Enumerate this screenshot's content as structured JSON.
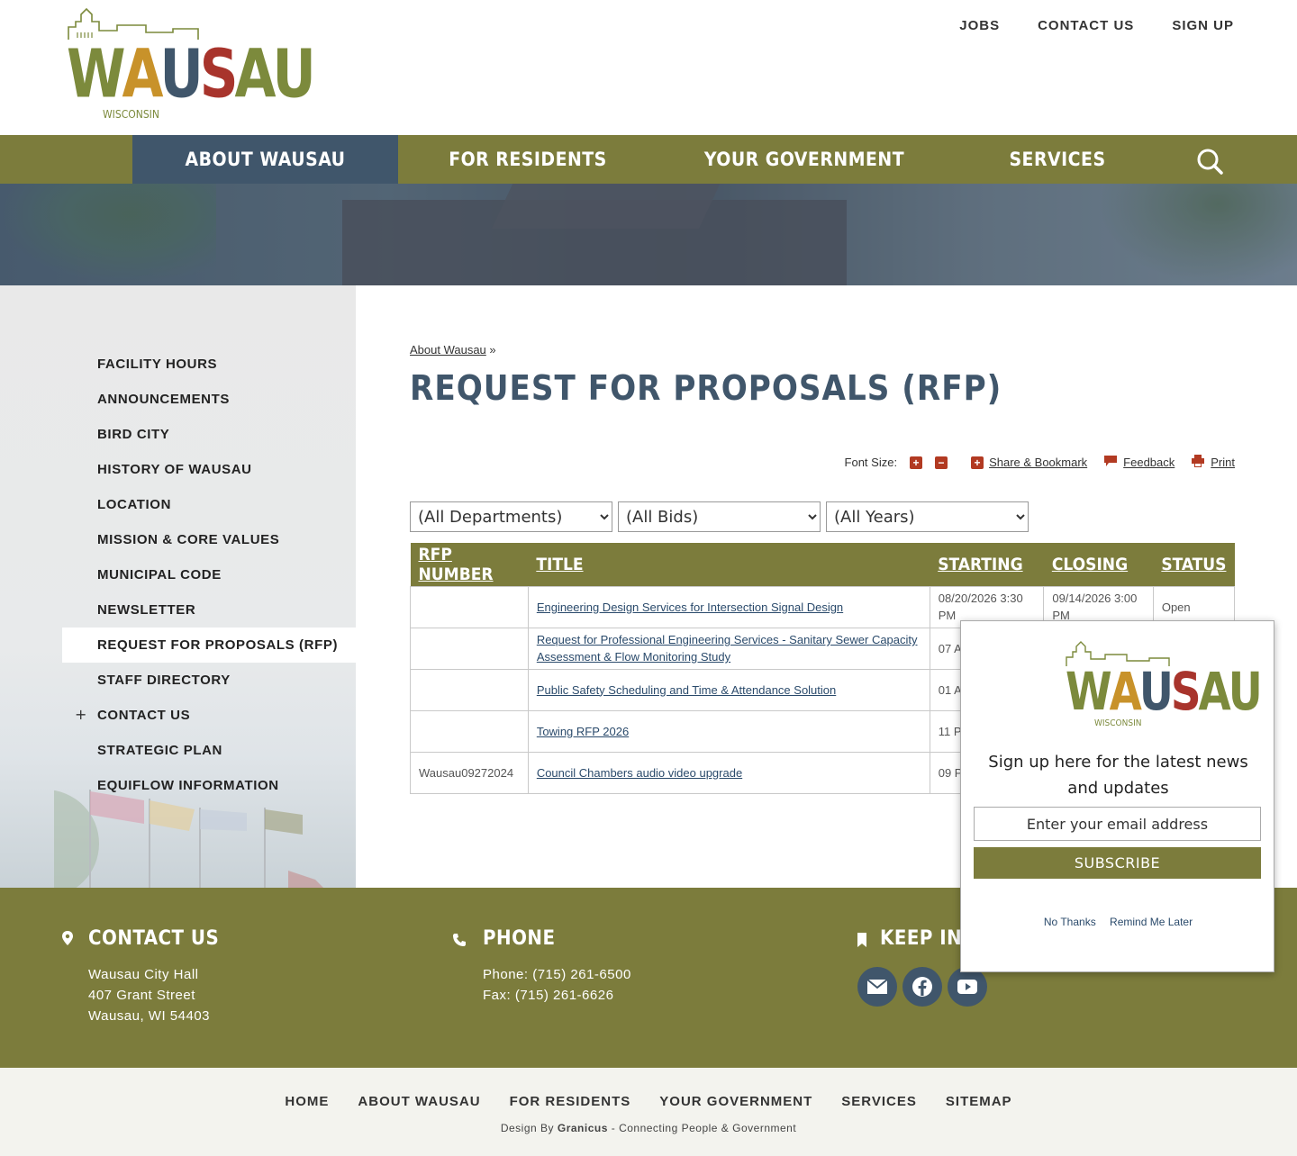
{
  "brand": {
    "name_letters": [
      "W",
      "A",
      "U",
      "S",
      "A",
      "U"
    ],
    "letter_colors": [
      "#7c8a3c",
      "#c8922a",
      "#40566b",
      "#a8342c",
      "#7c8a3c",
      "#7c8a3c"
    ],
    "subtitle": "WISCONSIN"
  },
  "top_links": [
    "JOBS",
    "CONTACT US",
    "SIGN UP"
  ],
  "main_nav": [
    "ABOUT WAUSAU",
    "FOR RESIDENTS",
    "YOUR GOVERNMENT",
    "SERVICES"
  ],
  "sidebar": {
    "items": [
      {
        "label": "FACILITY HOURS"
      },
      {
        "label": "ANNOUNCEMENTS"
      },
      {
        "label": "BIRD CITY"
      },
      {
        "label": "HISTORY OF WAUSAU"
      },
      {
        "label": "LOCATION"
      },
      {
        "label": "MISSION & CORE VALUES"
      },
      {
        "label": "MUNICIPAL CODE"
      },
      {
        "label": "NEWSLETTER"
      },
      {
        "label": "REQUEST FOR PROPOSALS (RFP)"
      },
      {
        "label": "STAFF DIRECTORY"
      },
      {
        "label": "CONTACT US"
      },
      {
        "label": "STRATEGIC PLAN"
      },
      {
        "label": "EQUIFLOW INFORMATION"
      }
    ],
    "expand_symbol": "+"
  },
  "breadcrumb": {
    "link": "About Wausau",
    "separator": "»"
  },
  "page_title": "REQUEST FOR PROPOSALS (RFP)",
  "tools": {
    "font_size_label": "Font Size:",
    "increase": "+",
    "decrease": "−",
    "share": "Share & Bookmark",
    "feedback": "Feedback",
    "print": "Print"
  },
  "filters": {
    "department": "(All Departments)",
    "bids": "(All Bids)",
    "years": "(All Years)"
  },
  "table": {
    "headers": [
      "RFP NUMBER",
      "TITLE",
      "STARTING",
      "CLOSING",
      "STATUS"
    ],
    "rows": [
      {
        "number": "",
        "title": "Engineering Design Services for Intersection Signal Design",
        "starting": "08/20/2026 3:30 PM",
        "closing": "09/14/2026 3:00 PM",
        "status": "Open"
      },
      {
        "number": "",
        "title": "Request for Professional Engineering Services - Sanitary Sewer Capacity Assessment & Flow Monitoring Study",
        "starting": "07 AM",
        "closing": "",
        "status": ""
      },
      {
        "number": "",
        "title": "Public Safety Scheduling and Time & Attendance Solution",
        "starting": "01 AM",
        "closing": "",
        "status": ""
      },
      {
        "number": "",
        "title": "Towing RFP 2026",
        "starting": "11 PM",
        "closing": "",
        "status": ""
      },
      {
        "number": "Wausau09272024",
        "title": "Council Chambers audio video upgrade",
        "starting": "09 PM",
        "closing": "",
        "status": ""
      }
    ]
  },
  "footer": {
    "contact": {
      "heading": "CONTACT US",
      "line1": "Wausau City Hall",
      "line2": "407 Grant Street",
      "line3": "Wausau, WI 54403"
    },
    "phone": {
      "heading": "PHONE",
      "line1": "Phone: (715) 261-6500",
      "line2": "Fax: (715) 261-6626"
    },
    "keep": {
      "heading": "KEEP IN T"
    }
  },
  "bottom_nav": [
    "HOME",
    "ABOUT WAUSAU",
    "FOR RESIDENTS",
    "YOUR GOVERNMENT",
    "SERVICES",
    "SITEMAP"
  ],
  "credit": {
    "prefix": "Design By",
    "company": "Granicus",
    "suffix": "- Connecting People & Government"
  },
  "popup": {
    "text": "Sign up here for the latest news and updates",
    "email_placeholder": "Enter your email address",
    "subscribe": "SUBSCRIBE",
    "no_thanks": "No Thanks",
    "remind": "Remind Me Later"
  }
}
